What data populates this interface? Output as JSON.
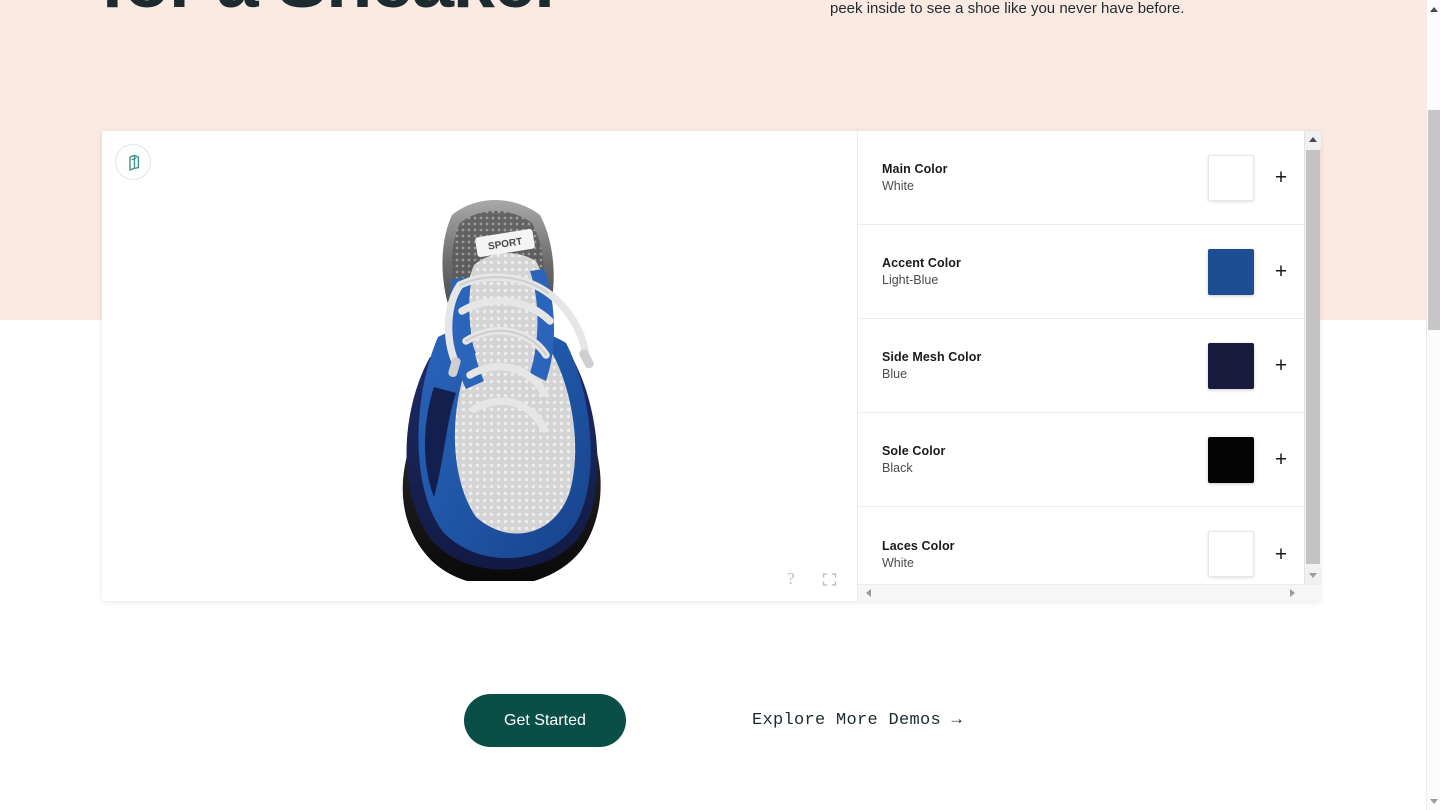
{
  "hero": {
    "heading": "for a Sneaker",
    "subtext": "peek inside to see a shoe like you never have before."
  },
  "viewer": {
    "brand_logo_icon": "cube-logo-icon",
    "help_icon": "?",
    "fullscreen_icon": "fullscreen-icon",
    "product_label": "SPORT"
  },
  "panel": {
    "options": [
      {
        "title": "Main Color",
        "value": "White",
        "color": "#ffffff",
        "add_label": "+"
      },
      {
        "title": "Accent Color",
        "value": "Light-Blue",
        "color": "#1d4e94",
        "add_label": "+"
      },
      {
        "title": "Side Mesh Color",
        "value": "Blue",
        "color": "#191b3c",
        "add_label": "+"
      },
      {
        "title": "Sole Color",
        "value": "Black",
        "color": "#040404",
        "add_label": "+"
      },
      {
        "title": "Laces Color",
        "value": "White",
        "color": "#ffffff",
        "add_label": "+"
      }
    ]
  },
  "cta": {
    "primary_label": "Get Started",
    "secondary_label": "Explore More Demos  →"
  },
  "colors": {
    "hero_background": "#fbeae2",
    "heading_text": "#1d2b30",
    "primary_button": "#0a4f46",
    "brand_teal": "#3e8f83"
  }
}
